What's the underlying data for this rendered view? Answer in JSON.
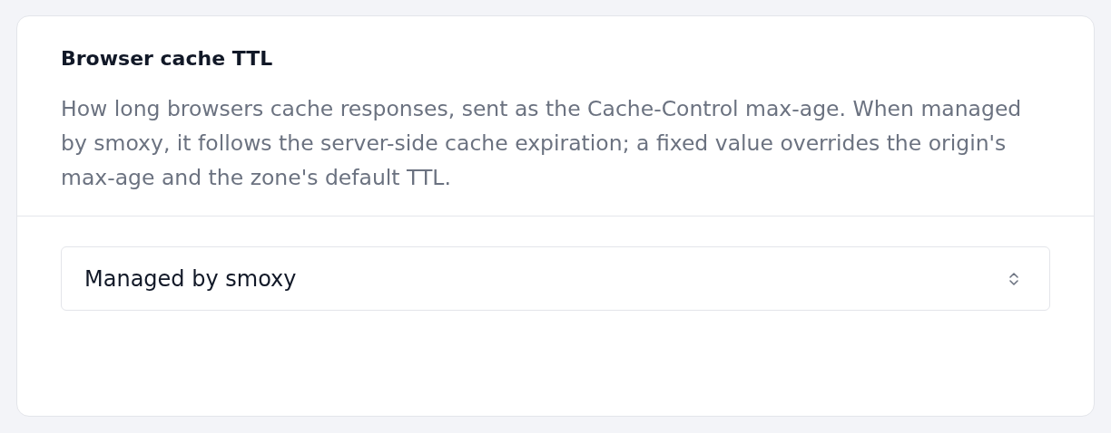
{
  "card": {
    "title": "Browser cache TTL",
    "description": "How long browsers cache responses, sent as the Cache-Control max-age. When managed by smoxy, it follows the server-side cache expiration; a fixed value overrides the origin's max-age and the zone's default TTL.",
    "select": {
      "value": "Managed by smoxy"
    }
  }
}
